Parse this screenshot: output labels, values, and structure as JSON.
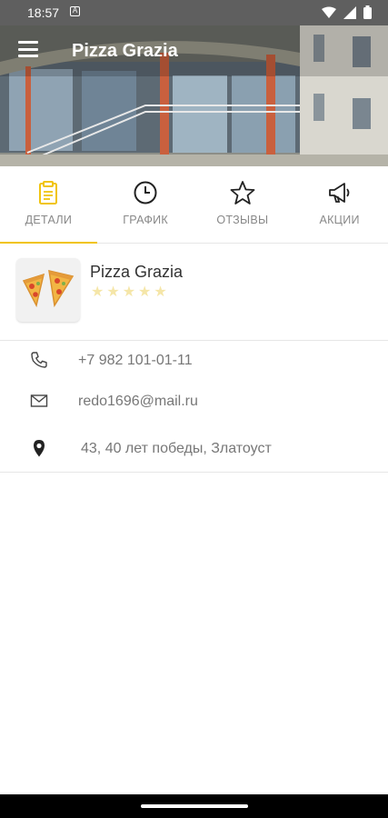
{
  "status_bar": {
    "time": "18:57",
    "notif_glyph": "A"
  },
  "app_bar": {
    "title": "Pizza Grazia",
    "menu_icon": "hamburger-menu-icon"
  },
  "tabs": [
    {
      "label": "ДЕТАЛИ",
      "icon": "clipboard-icon",
      "active": true
    },
    {
      "label": "ГРАФИК",
      "icon": "clock-icon",
      "active": false
    },
    {
      "label": "ОТЗЫВЫ",
      "icon": "star-outline-icon",
      "active": false
    },
    {
      "label": "АКЦИИ",
      "icon": "megaphone-icon",
      "active": false
    }
  ],
  "restaurant": {
    "name": "Pizza Grazia",
    "rating": 0,
    "max_rating": 5
  },
  "contacts": {
    "phone": "+7 982 101-01-11",
    "email": "redo1696@mail.ru",
    "address": "43, 40 лет победы, Златоуст"
  },
  "colors": {
    "accent": "#f1c40f",
    "star_empty": "#f5e6a8",
    "status_bar": "#5f5f5f"
  }
}
